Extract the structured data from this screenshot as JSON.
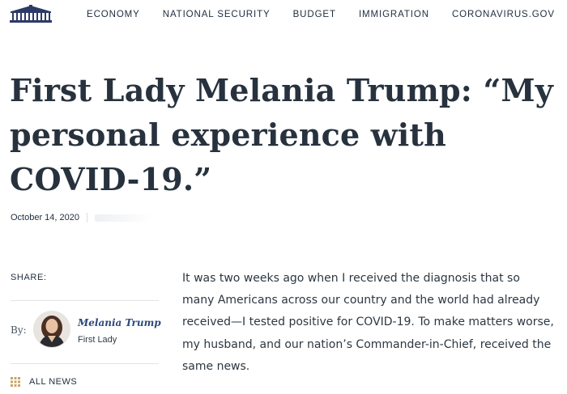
{
  "nav": {
    "items": [
      {
        "label": "ECONOMY"
      },
      {
        "label": "NATIONAL SECURITY"
      },
      {
        "label": "BUDGET"
      },
      {
        "label": "IMMIGRATION"
      },
      {
        "label": "CORONAVIRUS.GOV"
      }
    ]
  },
  "article": {
    "title": "First Lady Melania Trump: “My personal experience with COVID-19.”",
    "date": "October 14, 2020",
    "share_label": "SHARE:",
    "by_label": "By:",
    "author_name": "Melania Trump",
    "author_title": "First Lady",
    "all_news_label": "ALL NEWS",
    "body": "It was two weeks ago when I received the diagnosis that so many Americans across our country and the world had already received—I tested positive for COVID-19. To make matters worse, my husband, and our nation’s Commander-in-Chief, received the same news."
  },
  "colors": {
    "text_dark": "#27323e",
    "author_link": "#2b4a7a",
    "grid_icon": "#c7a46a"
  },
  "icons": {
    "logo": "white-house-logo-icon",
    "all_news": "grid-icon"
  }
}
